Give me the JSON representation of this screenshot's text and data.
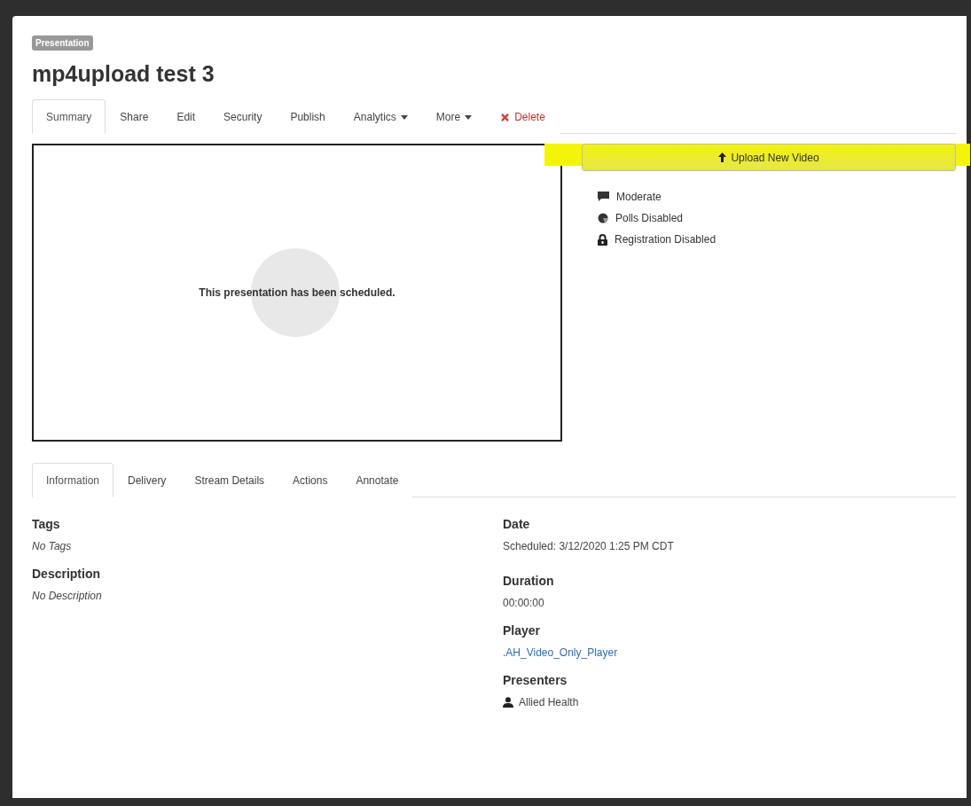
{
  "badge": "Presentation",
  "title": "mp4upload test 3",
  "tabs": [
    {
      "label": "Summary",
      "selected": true,
      "kind": "plain"
    },
    {
      "label": "Share",
      "selected": false,
      "kind": "plain"
    },
    {
      "label": "Edit",
      "selected": false,
      "kind": "plain"
    },
    {
      "label": "Security",
      "selected": false,
      "kind": "plain"
    },
    {
      "label": "Publish",
      "selected": false,
      "kind": "plain"
    },
    {
      "label": "Analytics",
      "selected": false,
      "kind": "dropdown"
    },
    {
      "label": "More",
      "selected": false,
      "kind": "dropdown"
    },
    {
      "label": "Delete",
      "selected": false,
      "kind": "danger"
    }
  ],
  "video": {
    "message": "This presentation has been scheduled."
  },
  "upload_button": {
    "label": "Upload New Video",
    "highlighted": true
  },
  "features": [
    {
      "label": "Moderate",
      "kind": "comment"
    },
    {
      "label": "Polls Disabled",
      "kind": "poll"
    },
    {
      "label": "Registration Disabled",
      "kind": "lock"
    }
  ],
  "detail_tabs": [
    {
      "label": "Information",
      "selected": true
    },
    {
      "label": "Delivery",
      "selected": false
    },
    {
      "label": "Stream Details",
      "selected": false
    },
    {
      "label": "Actions",
      "selected": false
    },
    {
      "label": "Annotate",
      "selected": false
    }
  ],
  "details_left": [
    {
      "heading": "Tags",
      "value": "No Tags",
      "kind": "empty"
    },
    {
      "heading": "Description",
      "value": "No Description",
      "kind": "empty"
    }
  ],
  "details_right": [
    {
      "heading": "Date",
      "value": "Scheduled: 3/12/2020 1:25 PM CDT",
      "kind": "text"
    },
    {
      "heading": "Duration",
      "value": "00:00:00",
      "kind": "text"
    },
    {
      "heading": "Player",
      "value": ".AH_Video_Only_Player",
      "kind": "link"
    },
    {
      "heading": "Presenters",
      "value": "Allied Health",
      "kind": "person"
    }
  ]
}
